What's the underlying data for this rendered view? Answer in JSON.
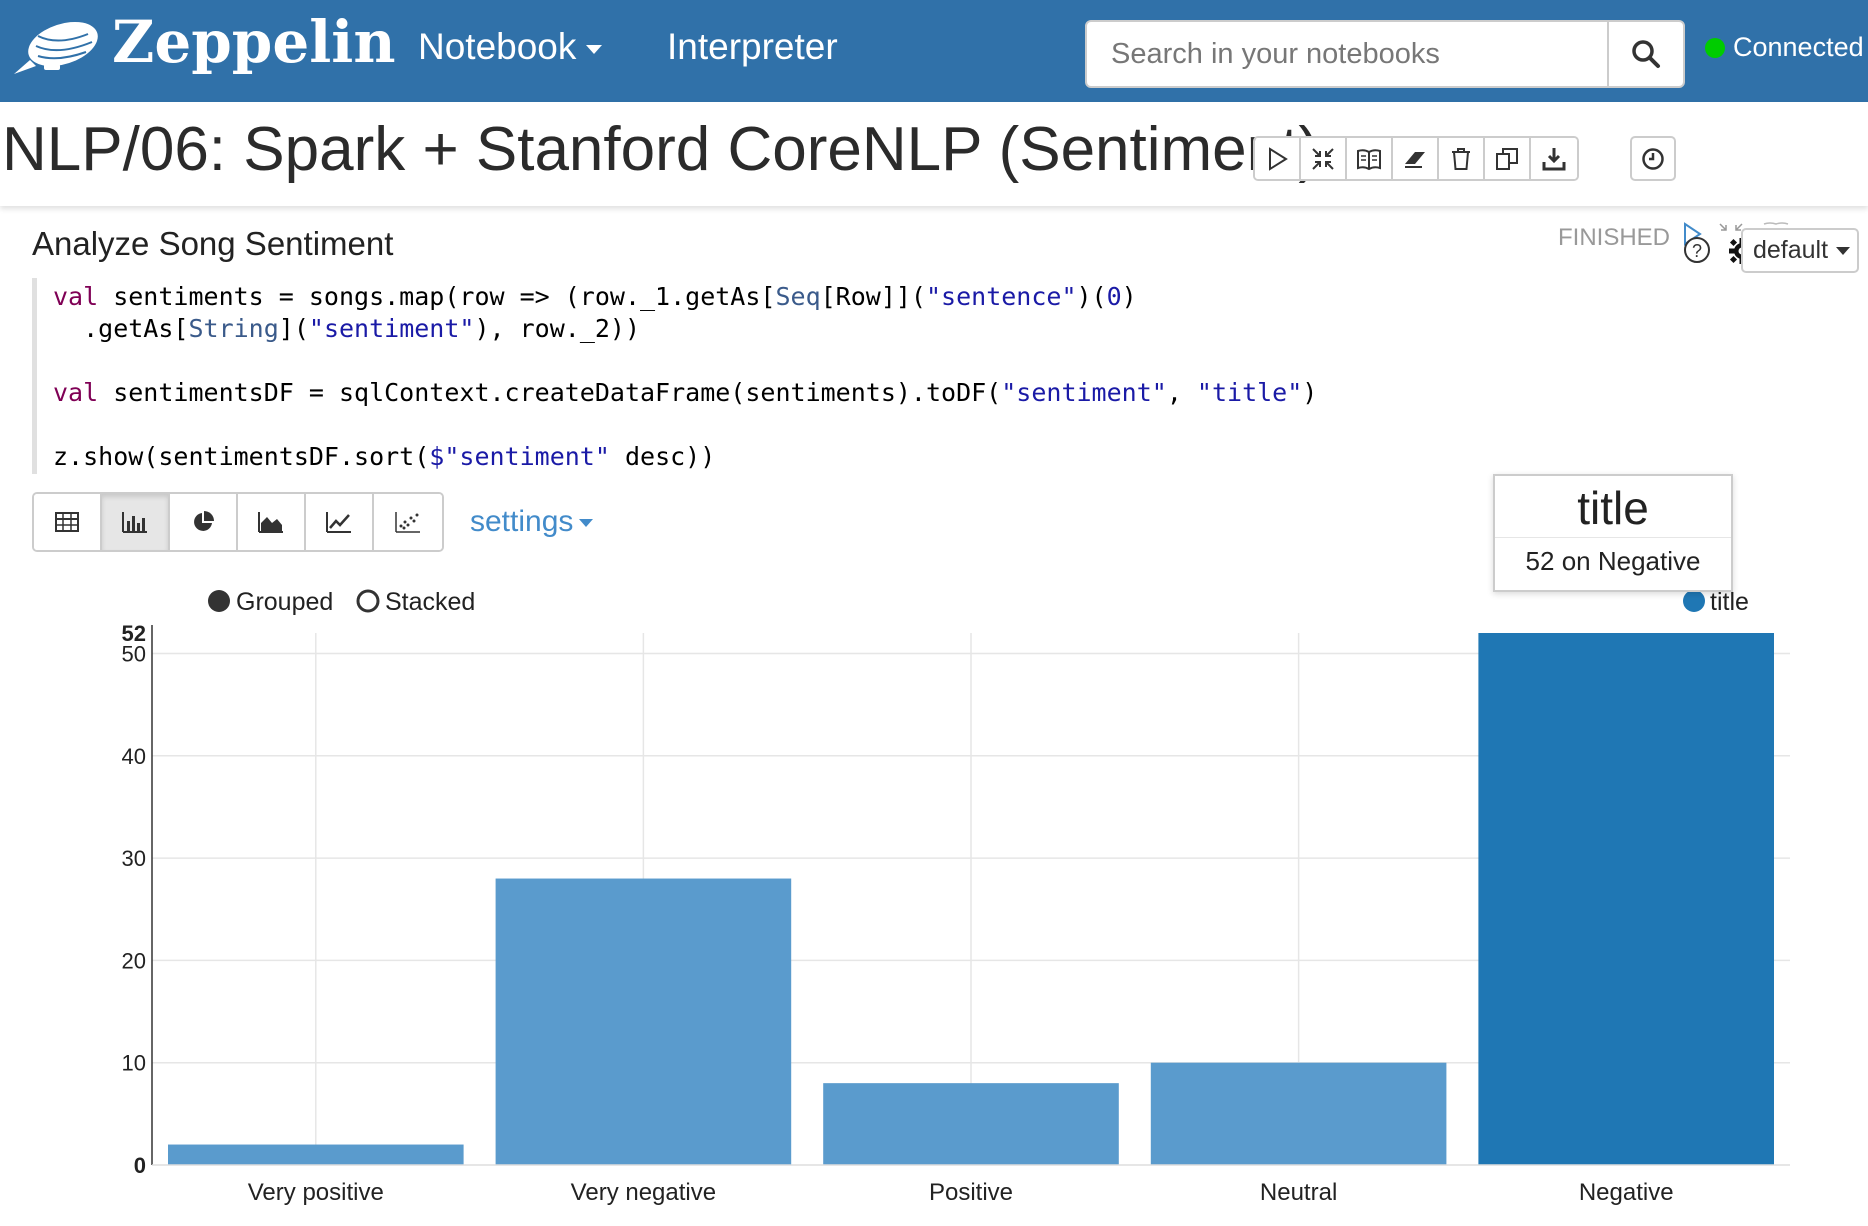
{
  "navbar": {
    "brand": "Zeppelin",
    "notebook_label": "Notebook",
    "interpreter_label": "Interpreter",
    "search_placeholder": "Search in your notebooks",
    "status_label": "Connected",
    "colors": {
      "navbar_bg": "#3071a9",
      "status_dot": "#00cc00"
    }
  },
  "notebook": {
    "title": "NLP/06: Spark + Stanford CoreNLP (Sentiment)",
    "toolbar_icons": [
      "run-all-icon",
      "collapse-code-icon",
      "show-output-icon",
      "clear-output-icon",
      "delete-icon",
      "clone-icon",
      "export-icon"
    ],
    "schedule_icon": "clock-icon"
  },
  "paragraph": {
    "title": "Analyze Song Sentiment",
    "status": "FINISHED",
    "mode_select": "default",
    "code": {
      "l1": {
        "kw": "val",
        "a": " sentiments = songs.map(row => (row._1.getAs[",
        "type1": "Seq",
        "b": "[Row]](",
        "s1": "\"sentence\"",
        "c": ")(",
        "n1": "0",
        "d": ")"
      },
      "l2": {
        "a": "  .getAs[",
        "type1": "String",
        "b": "](",
        "s1": "\"sentiment\"",
        "c": "), row._2))"
      },
      "l3": {
        "kw": "val",
        "a": " sentimentsDF = sqlContext.createDataFrame(sentiments).toDF(",
        "s1": "\"sentiment\"",
        "b": ", ",
        "s2": "\"title\"",
        "c": ")"
      },
      "l4": {
        "a": "z.show(sentimentsDF.sort(",
        "s1": "$\"sentiment\"",
        "b": " desc))"
      }
    },
    "viz_icons": [
      "table-icon",
      "bar-chart-icon",
      "pie-chart-icon",
      "area-chart-icon",
      "line-chart-icon",
      "scatter-chart-icon"
    ],
    "settings_label": "settings"
  },
  "tooltip": {
    "title": "title",
    "body": "52 on Negative"
  },
  "chart_data": {
    "type": "bar",
    "categories": [
      "Very positive",
      "Very negative",
      "Positive",
      "Neutral",
      "Negative"
    ],
    "series": [
      {
        "name": "title",
        "values": [
          2,
          28,
          8,
          10,
          52
        ]
      }
    ],
    "ylim": [
      0,
      52
    ],
    "yticks": [
      "0",
      "10",
      "20",
      "30",
      "40",
      "50",
      "52"
    ],
    "highlighted_category": "Negative",
    "grid": true,
    "legend": "top-right",
    "mode_options": {
      "grouped": "Grouped",
      "stacked": "Stacked",
      "selected": "Grouped"
    },
    "colors": {
      "bar": "#5a9bcd",
      "bar_highlight": "#1f77b4",
      "legend_dot": "#1f77b4",
      "grid": "#e6e6e6"
    }
  }
}
